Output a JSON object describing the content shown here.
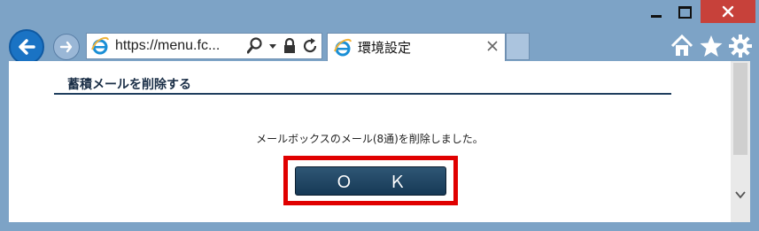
{
  "browser": {
    "address_url": "https://menu.fc...",
    "tab_title": "環境設定",
    "icons": {
      "back": "back-arrow-icon",
      "forward": "forward-arrow-icon",
      "home": "home-icon",
      "favorites": "star-icon",
      "tools": "gear-icon"
    }
  },
  "page": {
    "heading": "蓄積メールを削除する",
    "message": "メールボックスのメール(8通)を削除しました。",
    "ok_label": "Ｏ Ｋ"
  },
  "colors": {
    "highlight": "#e00000",
    "button": "#1f4463",
    "accent": "#1f3e5e"
  }
}
